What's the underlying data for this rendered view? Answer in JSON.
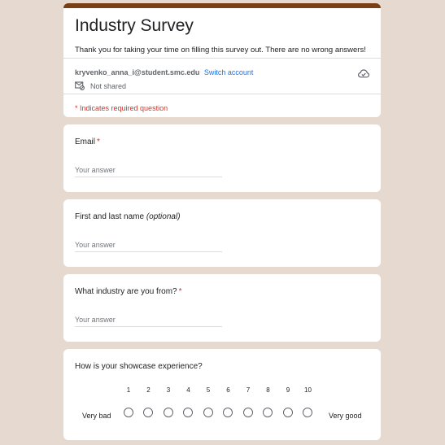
{
  "header": {
    "title": "Industry Survey",
    "description": "Thank you for taking your time on filling this survey out. There are no wrong answers!",
    "account_email": "kryvenko_anna_i@student.smc.edu",
    "switch_account": "Switch account",
    "not_shared": "Not shared",
    "required_note": "* Indicates required question"
  },
  "questions": [
    {
      "label": "Email",
      "required_mark": "*",
      "placeholder": "Your answer",
      "value": ""
    },
    {
      "label": "First and last name",
      "optional": "(optional)",
      "placeholder": "Your answer",
      "value": ""
    },
    {
      "label": "What industry are you from?",
      "required_mark": "*",
      "placeholder": "Your answer",
      "value": ""
    }
  ],
  "scale_question": {
    "label": "How is your showcase experience?",
    "low_label": "Very bad",
    "high_label": "Very good",
    "options": [
      "1",
      "2",
      "3",
      "4",
      "5",
      "6",
      "7",
      "8",
      "9",
      "10"
    ]
  },
  "colors": {
    "theme": "#7b3f16",
    "background": "#e6d9d0",
    "required": "#d93025",
    "link": "#1a73e8"
  },
  "icons": {
    "shared": "not-shared-icon",
    "cloud": "cloud-save-icon"
  }
}
